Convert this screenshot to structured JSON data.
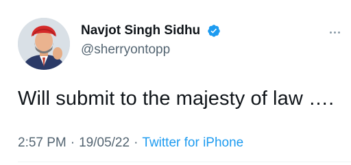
{
  "tweet": {
    "author": {
      "display_name": "Navjot Singh Sidhu",
      "handle": "@sherryontopp",
      "verified": true
    },
    "text": "Will submit to the majesty of law ….",
    "time": "2:57 PM",
    "date": "19/05/22",
    "separator": "·",
    "source": "Twitter for iPhone"
  },
  "colors": {
    "text": "#0f1419",
    "secondary_text": "#536471",
    "link_blue": "#1d9bf0",
    "verified_blue": "#1d9bf0",
    "turban_red": "#d42a2a"
  },
  "icons": {
    "verified": "verified-badge-icon",
    "more": "more-options-icon"
  }
}
